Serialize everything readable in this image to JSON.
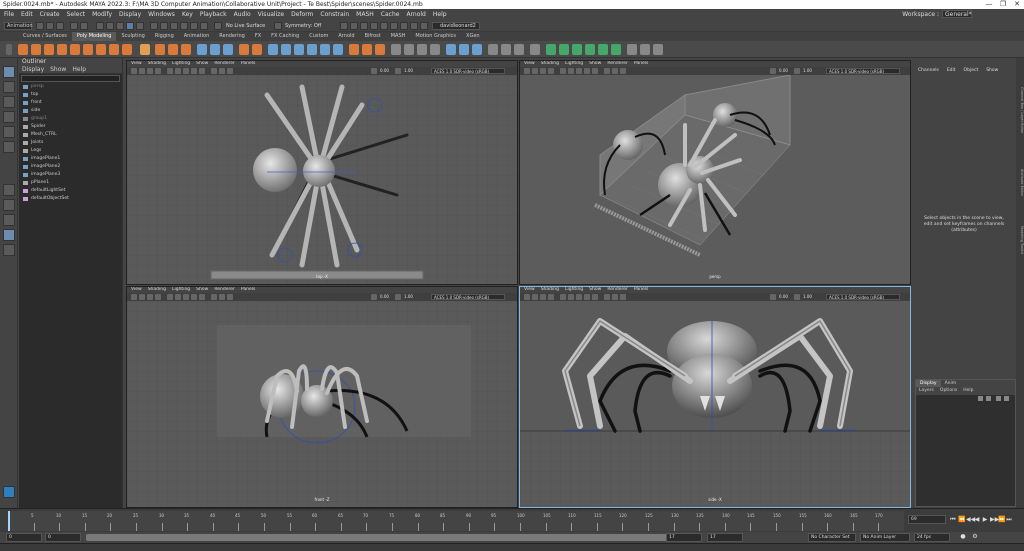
{
  "window": {
    "title": "Spider.0024.mb* - Autodesk MAYA 2022.3: F:\\MA 3D Computer Animation\\Collaborative Unit\\Project - Te Best\\Spider\\scenes\\Spider.0024.mb",
    "minimize": "—",
    "maximize": "❐",
    "close": "✕"
  },
  "menubar": {
    "items": [
      "File",
      "Edit",
      "Create",
      "Select",
      "Modify",
      "Display",
      "Windows",
      "Key",
      "Playback",
      "Audio",
      "Visualize",
      "Deform",
      "Constrain",
      "MASH",
      "Cache",
      "Arnold",
      "Help"
    ],
    "workspace_label": "Workspace :",
    "workspace_value": "General*"
  },
  "statusline": {
    "mode": "Animation",
    "live_surface": "No Live Surface",
    "symmetry": "Symmetry: Off",
    "user": "davidleonard2"
  },
  "shelf": {
    "tabs": [
      "Curves / Surfaces",
      "Poly Modeling",
      "Sculpting",
      "Rigging",
      "Animation",
      "Rendering",
      "FX",
      "FX Caching",
      "Custom",
      "Arnold",
      "Bifrost",
      "MASH",
      "Motion Graphics",
      "XGen"
    ],
    "active_tab": 1
  },
  "outliner": {
    "title": "Outliner",
    "menu": [
      "Display",
      "Show",
      "Help"
    ],
    "items": [
      {
        "label": "persp",
        "hidden": true
      },
      {
        "label": "top",
        "hidden": false
      },
      {
        "label": "front",
        "hidden": false
      },
      {
        "label": "side",
        "hidden": false
      },
      {
        "label": "group1",
        "hidden": true
      },
      {
        "label": "Spider",
        "hidden": false
      },
      {
        "label": "Mesh_CTRL",
        "hidden": false
      },
      {
        "label": "Joints",
        "hidden": false
      },
      {
        "label": "Legs",
        "hidden": false
      },
      {
        "label": "imagePlane1",
        "hidden": false
      },
      {
        "label": "imagePlane2",
        "hidden": false
      },
      {
        "label": "imagePlane3",
        "hidden": false
      },
      {
        "label": "pPlane1",
        "hidden": false
      },
      {
        "label": "defaultLightSet",
        "hidden": false
      },
      {
        "label": "defaultObjectSet",
        "hidden": false
      }
    ]
  },
  "viewport_menu": [
    "View",
    "Shading",
    "Lighting",
    "Show",
    "Renderer",
    "Panels"
  ],
  "viewports": [
    {
      "camera": "top -X",
      "exposure": "0.00",
      "gamma": "1.00",
      "colorspace": "ACES 1.0 SDR-video (sRGB)"
    },
    {
      "camera": "persp",
      "exposure": "0.00",
      "gamma": "1.00",
      "colorspace": "ACES 1.0 SDR-video (sRGB)"
    },
    {
      "camera": "front -Z",
      "exposure": "0.00",
      "gamma": "1.00",
      "colorspace": "ACES 1.0 SDR-video (sRGB)"
    },
    {
      "camera": "side -X",
      "exposure": "0.00",
      "gamma": "1.00",
      "colorspace": "ACES 1.0 SDR-video (sRGB)"
    }
  ],
  "channelbox": {
    "menu": [
      "Channels",
      "Edit",
      "Object",
      "Show"
    ],
    "message": "Select objects in the scene to view, edit and set keyframes on channels (attributes)"
  },
  "side_tabs": [
    "Channel Box / Layer Editor",
    "Attribute Editor",
    "Modeling Toolkit"
  ],
  "layer_editor": {
    "tabs": [
      "Display",
      "Anim"
    ],
    "menu": [
      "Layers",
      "Options",
      "Help"
    ]
  },
  "timeslider": {
    "tick_labels": [
      "5",
      "10",
      "15",
      "20",
      "25",
      "30",
      "35",
      "40",
      "45",
      "50",
      "55",
      "60",
      "65",
      "70",
      "75",
      "80",
      "85",
      "90",
      "95",
      "100",
      "105",
      "110",
      "115",
      "120",
      "125",
      "130",
      "135",
      "140",
      "145",
      "150",
      "155",
      "160",
      "165",
      "170"
    ],
    "current_frame": "69",
    "buttons": [
      "⏮",
      "⏪",
      "◀◀",
      "◀",
      "▶",
      "▶▶",
      "⏩",
      "⏭"
    ]
  },
  "rangeslider": {
    "start": "0",
    "anim_start": "0",
    "range_end": "17",
    "anim_end": "17",
    "character_set": "No Character Set",
    "anim_layer": "No Anim Layer",
    "fps": "24 fps"
  },
  "colors": {
    "accent_orange": "#d87a3a",
    "accent_green": "#45a86a",
    "active_viewport": "#7fb8e8"
  }
}
